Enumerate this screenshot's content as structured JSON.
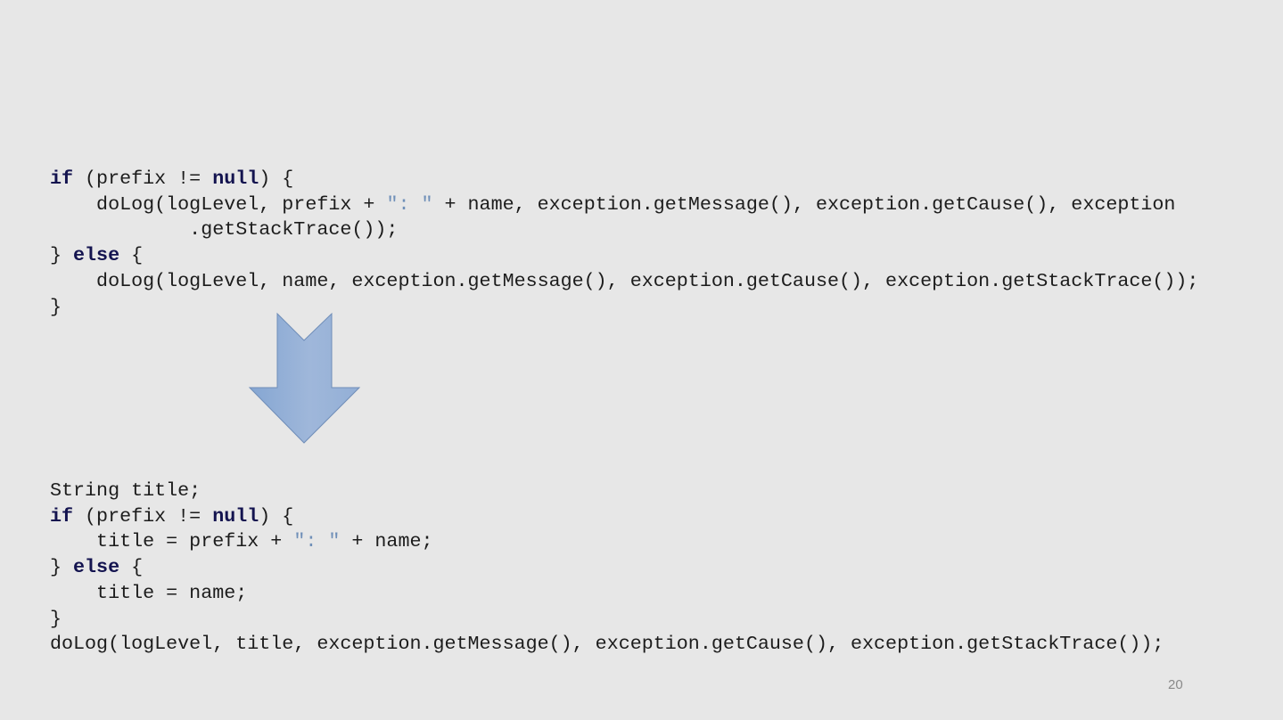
{
  "slide": {
    "page_number": "20",
    "arrow_color": "#8fadd6",
    "code_before": [
      [
        [
          "kw",
          "if"
        ],
        [
          "p",
          " (prefix != "
        ],
        [
          "kw",
          "null"
        ],
        [
          "p",
          ") {"
        ]
      ],
      [
        [
          "p",
          "    doLog(logLevel, prefix + "
        ],
        [
          "str",
          "\": \""
        ],
        [
          "p",
          " + name, exception.getMessage(), exception.getCause(), exception"
        ]
      ],
      [
        [
          "p",
          "            .getStackTrace());"
        ]
      ],
      [
        [
          "p",
          "} "
        ],
        [
          "kw",
          "else"
        ],
        [
          "p",
          " {"
        ]
      ],
      [
        [
          "p",
          "    doLog(logLevel, name, exception.getMessage(), exception.getCause(), exception.getStackTrace());"
        ]
      ],
      [
        [
          "p",
          "}"
        ]
      ]
    ],
    "code_after": [
      [
        [
          "p",
          "String title;"
        ]
      ],
      [
        [
          "kw",
          "if"
        ],
        [
          "p",
          " (prefix != "
        ],
        [
          "kw",
          "null"
        ],
        [
          "p",
          ") {"
        ]
      ],
      [
        [
          "p",
          "    title = prefix + "
        ],
        [
          "str",
          "\": \""
        ],
        [
          "p",
          " + name;"
        ]
      ],
      [
        [
          "p",
          "} "
        ],
        [
          "kw",
          "else"
        ],
        [
          "p",
          " {"
        ]
      ],
      [
        [
          "p",
          "    title = name;"
        ]
      ],
      [
        [
          "p",
          "}"
        ]
      ],
      [
        [
          "p",
          "doLog(logLevel, title, exception.getMessage(), exception.getCause(), exception.getStackTrace());"
        ]
      ]
    ]
  }
}
